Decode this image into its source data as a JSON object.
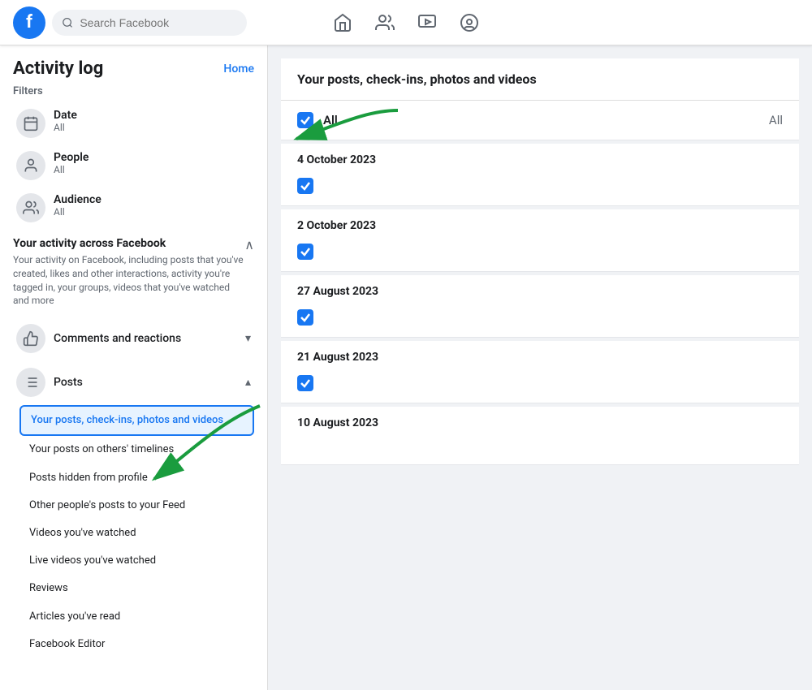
{
  "topNav": {
    "logoText": "f",
    "searchPlaceholder": "Search Facebook",
    "icons": [
      {
        "name": "home-icon",
        "symbol": "⌂",
        "label": "Home"
      },
      {
        "name": "people-icon",
        "symbol": "👥",
        "label": "Friends"
      },
      {
        "name": "watch-icon",
        "symbol": "▶",
        "label": "Watch"
      },
      {
        "name": "groups-icon",
        "symbol": "👤",
        "label": "Profile"
      }
    ]
  },
  "sidebar": {
    "title": "Activity log",
    "homeLink": "Home",
    "filtersLabel": "Filters",
    "filters": [
      {
        "name": "Date",
        "sub": "All",
        "icon": "📅"
      },
      {
        "name": "People",
        "sub": "All",
        "icon": "👤"
      },
      {
        "name": "Audience",
        "sub": "All",
        "icon": "👥"
      }
    ],
    "yourActivity": {
      "header": "Your activity across Facebook",
      "desc": "Your activity on Facebook, including posts that you've created, likes and other interactions, activity you're tagged in, your groups, videos that you've watched and more"
    },
    "categories": [
      {
        "name": "Comments and reactions",
        "icon": "👍",
        "expanded": false,
        "chevron": "▾",
        "subItems": []
      },
      {
        "name": "Posts",
        "icon": "≡",
        "expanded": true,
        "chevron": "▴",
        "subItems": [
          {
            "label": "Your posts, check-ins, photos and videos",
            "active": true
          },
          {
            "label": "Your posts on others' timelines",
            "active": false
          },
          {
            "label": "Posts hidden from profile",
            "active": false
          },
          {
            "label": "Other people's posts to your Feed",
            "active": false
          },
          {
            "label": "Videos you've watched",
            "active": false
          },
          {
            "label": "Live videos you've watched",
            "active": false
          },
          {
            "label": "Reviews",
            "active": false
          },
          {
            "label": "Articles you've read",
            "active": false
          },
          {
            "label": "Facebook Editor",
            "active": false
          }
        ]
      }
    ]
  },
  "main": {
    "sectionTitle": "Your posts, check-ins, photos and videos",
    "allRow": {
      "label": "All",
      "value": "All"
    },
    "dateSections": [
      {
        "date": "4 October 2023",
        "checked": true
      },
      {
        "date": "2 October 2023",
        "checked": true
      },
      {
        "date": "27 August 2023",
        "checked": true
      },
      {
        "date": "21 August 2023",
        "checked": true
      },
      {
        "date": "10 August 2023",
        "checked": false
      }
    ]
  }
}
